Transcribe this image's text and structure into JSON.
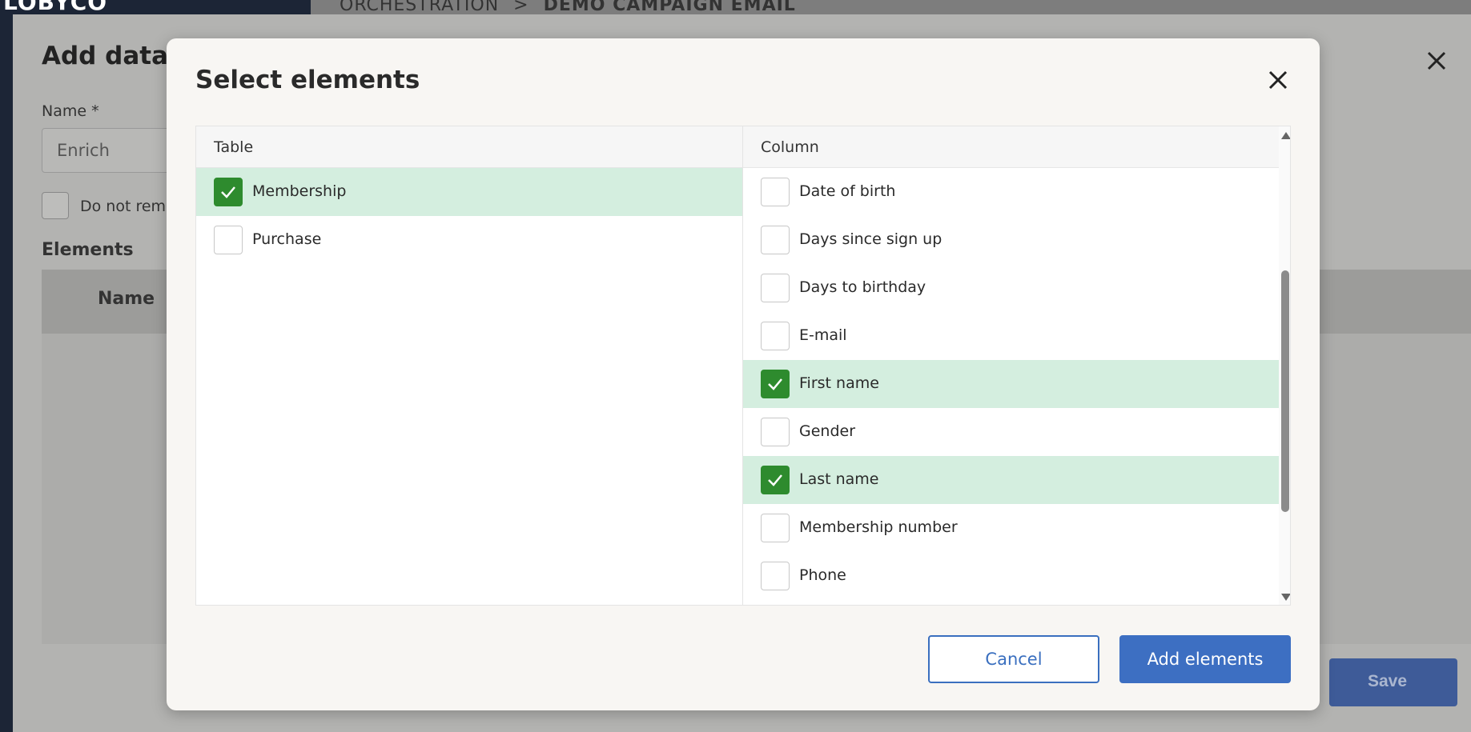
{
  "app": {
    "logo": "LOBYCO"
  },
  "breadcrumb": {
    "parent": "ORCHESTRATION",
    "separator": ">",
    "current": "DEMO CAMPAIGN EMAIL"
  },
  "drawer": {
    "title": "Add data e",
    "name_label": "Name *",
    "name_value": "Enrich",
    "checkbox_label": "Do not reme",
    "elements_label": "Elements",
    "table_header_name": "Name",
    "save_label": "Save"
  },
  "modal": {
    "title": "Select elements",
    "table_header": "Table",
    "column_header": "Column",
    "tables": [
      {
        "label": "Membership",
        "checked": true
      },
      {
        "label": "Purchase",
        "checked": false
      }
    ],
    "columns": [
      {
        "label": "Date of birth",
        "checked": false
      },
      {
        "label": "Days since sign up",
        "checked": false
      },
      {
        "label": "Days to birthday",
        "checked": false
      },
      {
        "label": "E-mail",
        "checked": false
      },
      {
        "label": "First name",
        "checked": true
      },
      {
        "label": "Gender",
        "checked": false
      },
      {
        "label": "Last name",
        "checked": true
      },
      {
        "label": "Membership number",
        "checked": false
      },
      {
        "label": "Phone",
        "checked": false
      }
    ],
    "cancel_label": "Cancel",
    "add_label": "Add elements"
  },
  "colors": {
    "accent": "#3d6fc2",
    "checked_bg": "#d4eedf",
    "check_green": "#2e8b2e"
  }
}
